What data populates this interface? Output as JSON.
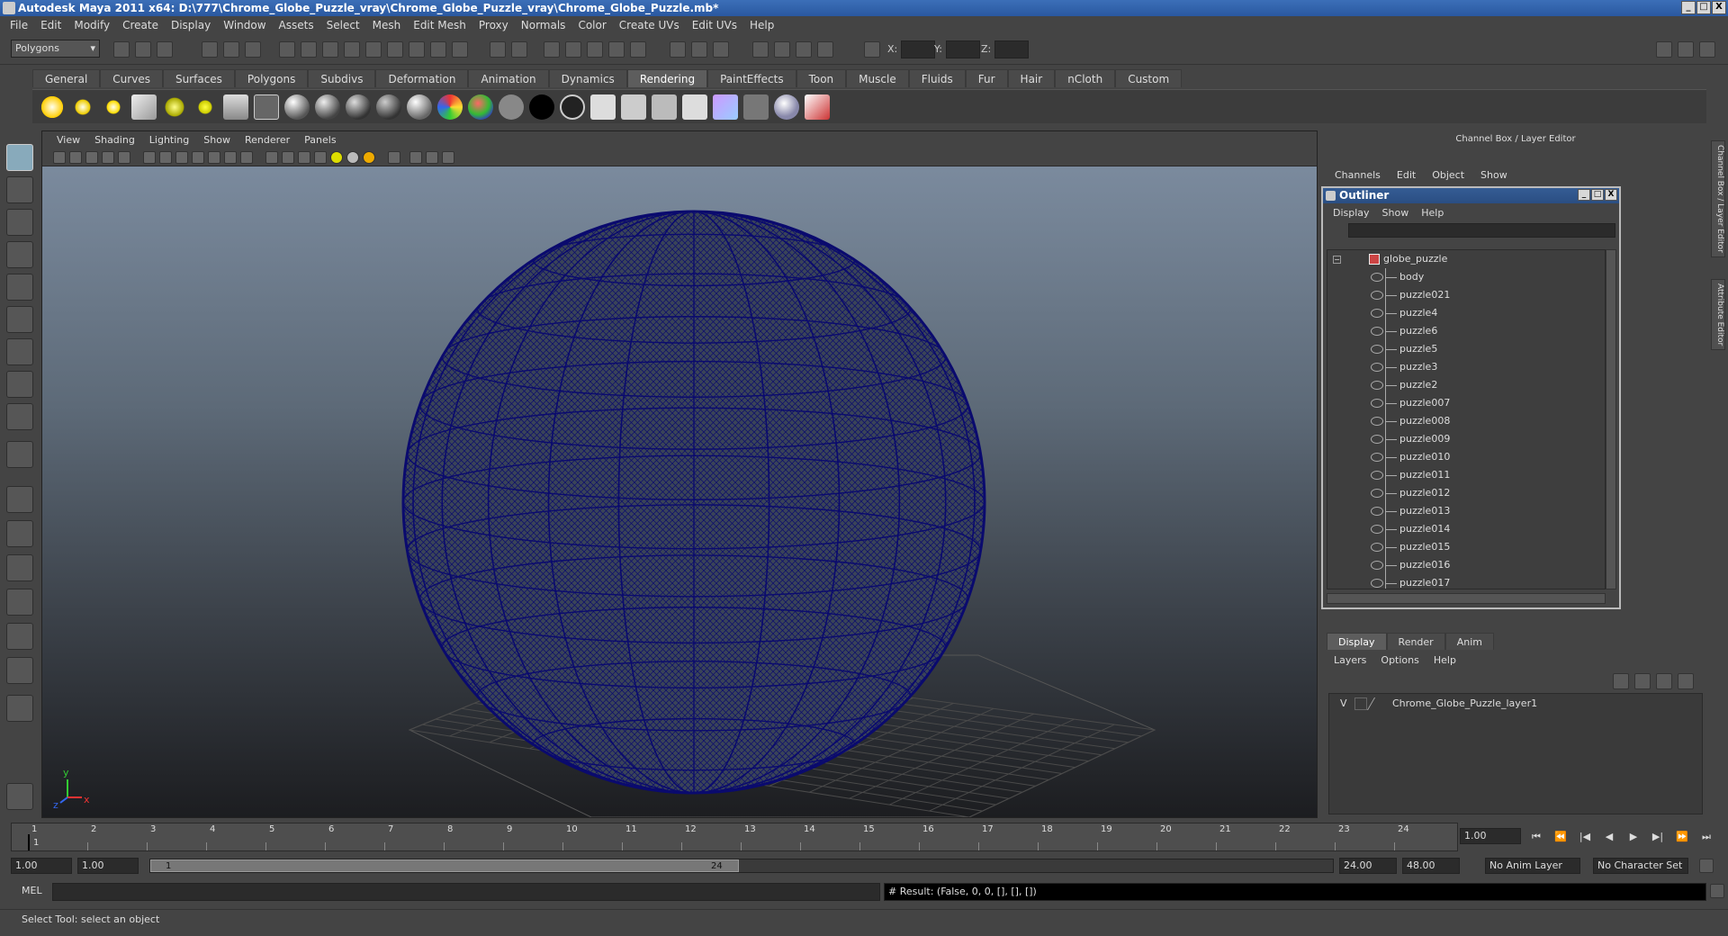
{
  "window": {
    "title": "Autodesk Maya 2011 x64: D:\\777\\Chrome_Globe_Puzzle_vray\\Chrome_Globe_Puzzle_vray\\Chrome_Globe_Puzzle.mb*",
    "min": "_",
    "max": "□",
    "close": "X"
  },
  "menubar": [
    "File",
    "Edit",
    "Modify",
    "Create",
    "Display",
    "Window",
    "Assets",
    "Select",
    "Mesh",
    "Edit Mesh",
    "Proxy",
    "Normals",
    "Color",
    "Create UVs",
    "Edit UVs",
    "Help"
  ],
  "statusline": {
    "mode": "Polygons",
    "x_label": "X:",
    "y_label": "Y:",
    "z_label": "Z:"
  },
  "shelf": {
    "tabs": [
      "General",
      "Curves",
      "Surfaces",
      "Polygons",
      "Subdivs",
      "Deformation",
      "Animation",
      "Dynamics",
      "Rendering",
      "PaintEffects",
      "Toon",
      "Muscle",
      "Fluids",
      "Fur",
      "Hair",
      "nCloth",
      "Custom"
    ],
    "active_tab": "Rendering"
  },
  "viewport": {
    "menu": [
      "View",
      "Shading",
      "Lighting",
      "Show",
      "Renderer",
      "Panels"
    ],
    "axis_y": "y",
    "axis_x": "x",
    "axis_z": "z",
    "wire_color": "#0a0a6e"
  },
  "channel_box": {
    "header": "Channel Box / Layer Editor",
    "menu": [
      "Channels",
      "Edit",
      "Object",
      "Show"
    ]
  },
  "outliner": {
    "title": "Outliner",
    "menu": [
      "Display",
      "Show",
      "Help"
    ],
    "root": "globe_puzzle",
    "root_toggle": "−",
    "items": [
      "body",
      "puzzle021",
      "puzzle4",
      "puzzle6",
      "puzzle5",
      "puzzle3",
      "puzzle2",
      "puzzle007",
      "puzzle008",
      "puzzle009",
      "puzzle010",
      "puzzle011",
      "puzzle012",
      "puzzle013",
      "puzzle014",
      "puzzle015",
      "puzzle016",
      "puzzle017"
    ],
    "win_min": "_",
    "win_max": "□",
    "win_close": "X"
  },
  "layer_editor": {
    "tabs": [
      "Display",
      "Render",
      "Anim"
    ],
    "active_tab": "Display",
    "menu": [
      "Layers",
      "Options",
      "Help"
    ],
    "layer_visible": "V",
    "layer_name": "Chrome_Globe_Puzzle_layer1"
  },
  "timeline": {
    "frames": [
      "1",
      "2",
      "3",
      "4",
      "5",
      "6",
      "7",
      "8",
      "9",
      "10",
      "11",
      "12",
      "13",
      "14",
      "15",
      "16",
      "17",
      "18",
      "19",
      "20",
      "21",
      "22",
      "23",
      "24"
    ],
    "current_marker": "1",
    "current_frame": "1.00",
    "buttons": [
      "⏮",
      "⏪",
      "|◀",
      "◀",
      "▶",
      "▶|",
      "⏩",
      "⏭"
    ]
  },
  "range": {
    "start": "1.00",
    "playback_start": "1.00",
    "slider_start": "1",
    "slider_end": "24",
    "playback_end": "24.00",
    "end": "48.00",
    "anim_layer": "No Anim Layer",
    "char_set": "No Character Set"
  },
  "command": {
    "label": "MEL",
    "result": "# Result: (False, 0, 0, [], [], [])"
  },
  "help_line": "Select Tool: select an object",
  "side_tabs": [
    "Channel Box / Layer Editor",
    "Attribute Editor"
  ]
}
